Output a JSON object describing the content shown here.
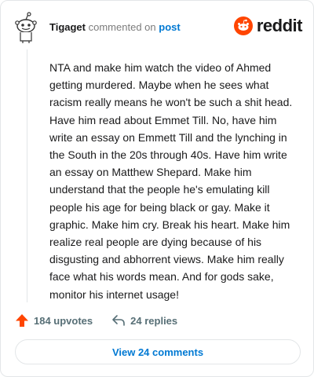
{
  "comment": {
    "author": "Tigaget",
    "verb": "commented on",
    "target": "post",
    "brand": "reddit",
    "body": "NTA and make him watch the video of Ahmed getting murdered. Maybe when he sees what racism really means he won't be such a shit head. Have him read about Emmet Till. No, have him write an essay on Emmett Till and the lynching in the South in the 20s through 40s. Have him write an essay on Matthew Shepard. Make him understand that the people he's emulating kill people his age for being black or gay. Make it graphic. Make him cry. Break his heart. Make him realize real people are dying because of his disgusting and abhorrent views. Make him really face what his words mean. And for gods sake, monitor his internet usage!"
  },
  "actions": {
    "upvotes_label": "184 upvotes",
    "replies_label": "24 replies",
    "view_comments_label": "View 24 comments"
  },
  "colors": {
    "reddit_orange": "#ff4500",
    "link_blue": "#0079d3",
    "muted": "#576f76"
  },
  "icons": {
    "avatar": "snoo-avatar-icon",
    "logo": "reddit-logo-icon",
    "upvote": "upvote-arrow-icon",
    "reply": "reply-arrow-icon"
  }
}
